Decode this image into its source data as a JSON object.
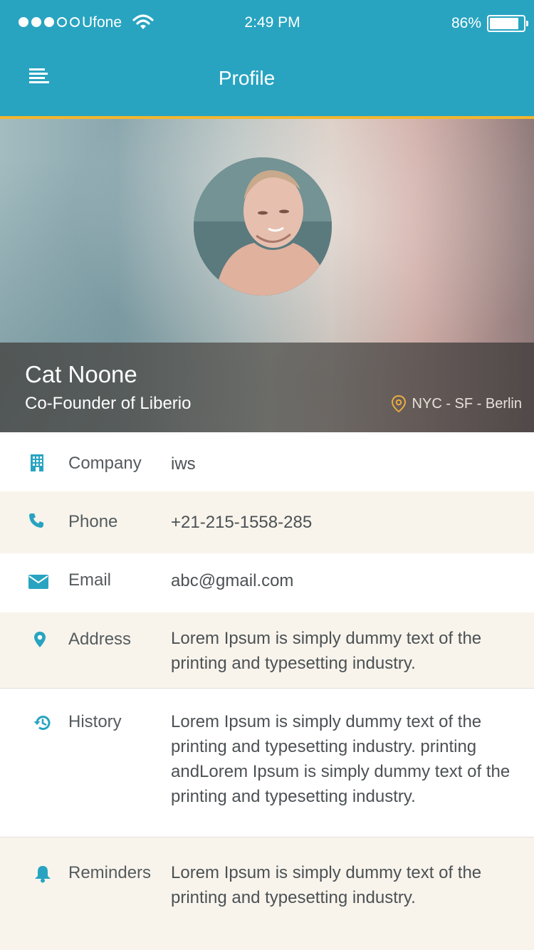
{
  "status_bar": {
    "carrier": "Ufone",
    "time": "2:49 PM",
    "battery_percent_text": "86%",
    "battery_level": 0.86,
    "signal_strength": 3,
    "signal_max": 5
  },
  "nav": {
    "title": "Profile",
    "menu_icon": "menu-icon"
  },
  "profile": {
    "name": "Cat Noone",
    "role": "Co-Founder of Liberio",
    "location": "NYC - SF - Berlin",
    "location_icon": "location-pin-icon"
  },
  "details": [
    {
      "icon": "building-icon",
      "label": "Company",
      "value": "iws"
    },
    {
      "icon": "phone-icon",
      "label": "Phone",
      "value": "+21-215-1558-285"
    },
    {
      "icon": "envelope-icon",
      "label": "Email",
      "value": "abc@gmail.com"
    },
    {
      "icon": "map-pin-icon",
      "label": "Address",
      "value": "Lorem Ipsum is simply dummy text of the printing and typesetting industry."
    },
    {
      "icon": "history-icon",
      "label": "History",
      "value": "Lorem Ipsum is simply dummy text of the printing and typesetting industry. printing andLorem Ipsum is simply dummy text of the  printing and typesetting industry."
    },
    {
      "icon": "bell-icon",
      "label": "Reminders",
      "value": "Lorem Ipsum is simply dummy text of the printing and typesetting industry."
    }
  ],
  "colors": {
    "header": "#28a4c1",
    "accent_line": "#f1b62f",
    "icon": "#28a4c1",
    "row_alt_bg": "#f8f4ec"
  }
}
